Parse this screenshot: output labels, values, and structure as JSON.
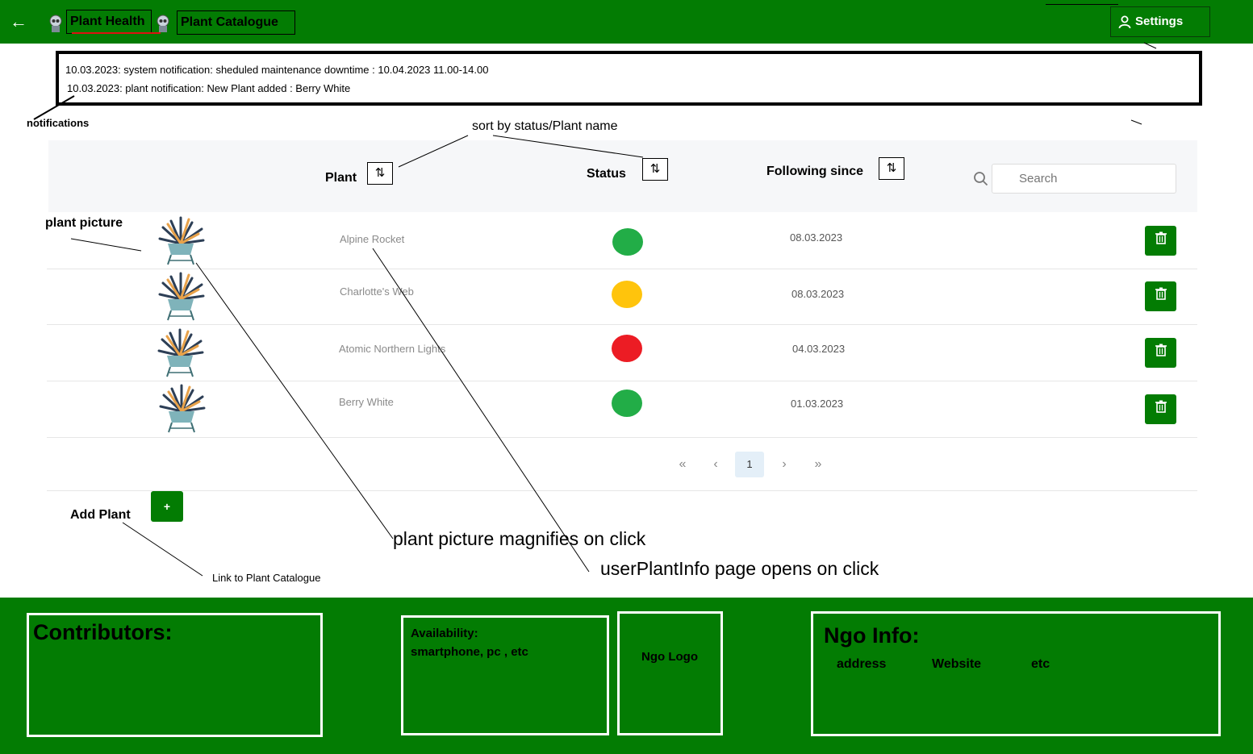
{
  "header": {
    "nav": [
      {
        "label": "Plant Health"
      },
      {
        "label": "Plant Catalogue"
      }
    ],
    "settings_label": "Settings"
  },
  "notifications": {
    "items": [
      "10.03.2023: system notification: sheduled maintenance downtime : 10.04.2023 11.00-14.00",
      "10.03.2023: plant notification: New Plant added : Berry White"
    ]
  },
  "annotations": {
    "notifications": "notifications",
    "sort": "sort by status/Plant name",
    "plant_picture": "plant picture",
    "magnify": "plant picture magnifies on click",
    "user_info": "userPlantInfo page opens on click",
    "catalogue_link": "Link to Plant Catalogue"
  },
  "table": {
    "columns": {
      "plant": "Plant",
      "status": "Status",
      "following": "Following since"
    },
    "search_placeholder": "Search",
    "rows": [
      {
        "plant": "Alpine Rocket",
        "status_color": "#22ad47",
        "following": "08.03.2023"
      },
      {
        "plant": "Charlotte's Web",
        "status_color": "#ffc40c",
        "following": "08.03.2023"
      },
      {
        "plant": "Atomic Northern Lights",
        "status_color": "#ec1c24",
        "following": "04.03.2023"
      },
      {
        "plant": "Berry White",
        "status_color": "#22ad47",
        "following": "01.03.2023"
      }
    ]
  },
  "pagination": {
    "first": "«",
    "prev": "‹",
    "current": "1",
    "next": "›",
    "last": "»"
  },
  "add_plant": {
    "label": "Add Plant",
    "button": "+"
  },
  "footer": {
    "contributors": "Contributors:",
    "availability_title": "Availability:",
    "availability_text": "smartphone, pc , etc",
    "ngo_logo": "Ngo Logo",
    "ngo_info_title": "Ngo Info:",
    "ngo_address": "address",
    "ngo_website": "Website",
    "ngo_etc": "etc"
  },
  "colors": {
    "brand_green": "#037c03",
    "pager_active": "#e4eff8"
  }
}
